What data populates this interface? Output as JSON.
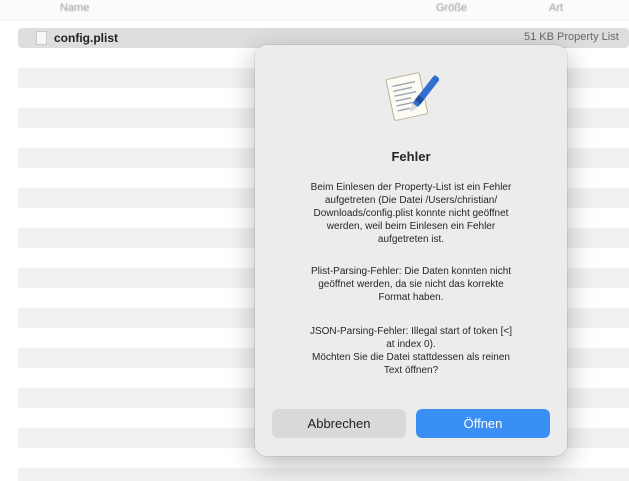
{
  "columns": {
    "name": "Name",
    "size": "Größe",
    "kind": "Art"
  },
  "files": [
    {
      "name": "config.plist",
      "size": "51 KB",
      "kind": "Property List"
    }
  ],
  "dialog": {
    "icon": "property-list-editor-icon",
    "title": "Fehler",
    "message1": "Beim Einlesen der Property-List ist ein Fehler\naufgetreten (Die Datei /Users/christian/\nDownloads/config.plist konnte nicht geöffnet\nwerden, weil beim Einlesen ein Fehler\naufgetreten ist.",
    "message2": "Plist-Parsing-Fehler: Die Daten konnten nicht\ngeöffnet werden, da sie nicht das korrekte\nFormat haben.",
    "message3": "JSON-Parsing-Fehler: Illegal start of token [<]\nat index 0).\nMöchten Sie die Datei stattdessen als reinen\nText öffnen?",
    "cancel_label": "Abbrechen",
    "open_label": "Öffnen",
    "accent_color": "#3a8ff5"
  }
}
